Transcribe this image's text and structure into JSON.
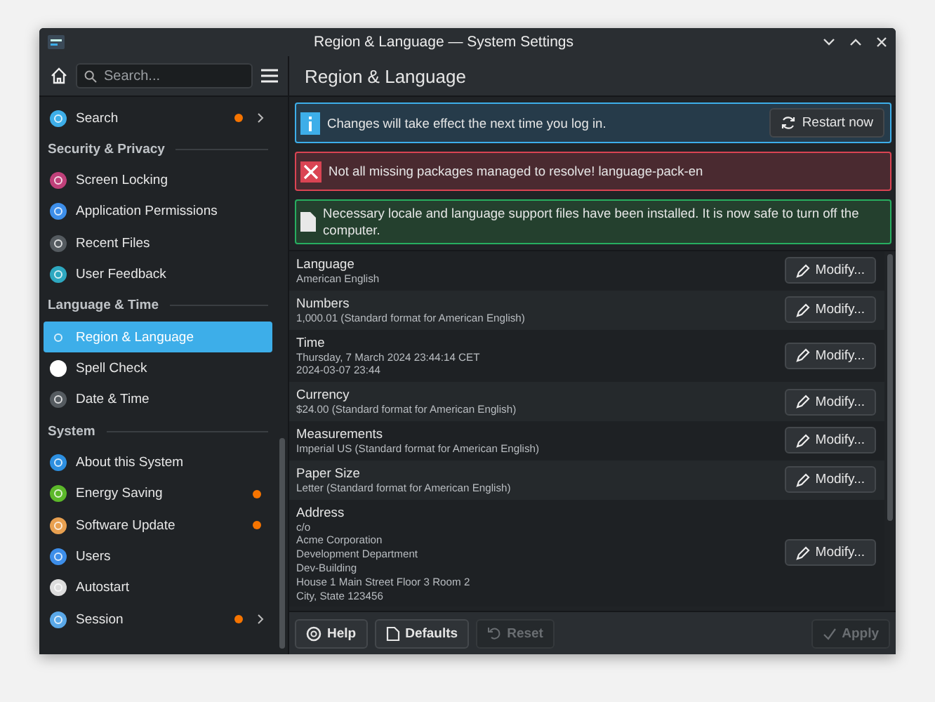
{
  "window": {
    "title": "Region & Language — System Settings"
  },
  "sidebar": {
    "search": {
      "placeholder": "Search..."
    },
    "items": [
      {
        "kind": "item",
        "label": "Search",
        "selected": false,
        "badge": true,
        "arrow": true
      },
      {
        "kind": "heading",
        "label": "Security & Privacy"
      },
      {
        "kind": "item",
        "label": "Screen Locking",
        "selected": false,
        "badge": false,
        "arrow": false
      },
      {
        "kind": "item",
        "label": "Application Permissions",
        "selected": false,
        "badge": false,
        "arrow": false
      },
      {
        "kind": "item",
        "label": "Recent Files",
        "selected": false,
        "badge": false,
        "arrow": false
      },
      {
        "kind": "item",
        "label": "User Feedback",
        "selected": false,
        "badge": false,
        "arrow": false
      },
      {
        "kind": "heading",
        "label": "Language & Time"
      },
      {
        "kind": "item",
        "label": "Region & Language",
        "selected": true,
        "badge": false,
        "arrow": false
      },
      {
        "kind": "item",
        "label": "Spell Check",
        "selected": false,
        "badge": false,
        "arrow": false
      },
      {
        "kind": "item",
        "label": "Date & Time",
        "selected": false,
        "badge": false,
        "arrow": false
      },
      {
        "kind": "heading",
        "label": "System"
      },
      {
        "kind": "item",
        "label": "About this System",
        "selected": false,
        "badge": false,
        "arrow": false
      },
      {
        "kind": "item",
        "label": "Energy Saving",
        "selected": false,
        "badge": true,
        "arrow": false
      },
      {
        "kind": "item",
        "label": "Software Update",
        "selected": false,
        "badge": true,
        "arrow": false
      },
      {
        "kind": "item",
        "label": "Users",
        "selected": false,
        "badge": false,
        "arrow": false
      },
      {
        "kind": "item",
        "label": "Autostart",
        "selected": false,
        "badge": false,
        "arrow": false
      },
      {
        "kind": "item",
        "label": "Session",
        "selected": false,
        "badge": true,
        "arrow": true
      }
    ]
  },
  "page": {
    "title": "Region & Language",
    "messages": [
      {
        "kind": "info",
        "text": "Changes will take effect the next time you log in.",
        "button": "Restart now"
      },
      {
        "kind": "error",
        "text": "Not all missing packages managed to resolve! language-pack-en"
      },
      {
        "kind": "positive",
        "text": "Necessary locale and language support files have been installed. It is now safe to turn off the computer."
      }
    ],
    "settings": [
      {
        "label": "Language",
        "lines": [
          "American English"
        ],
        "button": "Modify..."
      },
      {
        "label": "Numbers",
        "lines": [
          "1,000.01 (Standard format for American English)"
        ],
        "button": "Modify..."
      },
      {
        "label": "Time",
        "lines": [
          "Thursday, 7 March 2024 23:44:14 CET",
          "2024-03-07 23:44"
        ],
        "button": "Modify..."
      },
      {
        "label": "Currency",
        "lines": [
          "$24.00 (Standard format for American English)"
        ],
        "button": "Modify..."
      },
      {
        "label": "Measurements",
        "lines": [
          "Imperial US (Standard format for American English)"
        ],
        "button": "Modify..."
      },
      {
        "label": "Paper Size",
        "lines": [
          "Letter (Standard format for American English)"
        ],
        "button": "Modify..."
      },
      {
        "label": "Address",
        "lines": [
          "c/o",
          "Acme Corporation",
          "Development Department",
          "Dev-Building",
          "House 1 Main Street Floor 3 Room 2",
          "City, State 123456"
        ],
        "button": "Modify..."
      }
    ]
  },
  "footer": {
    "buttons": [
      {
        "kind": "help",
        "label": "Help",
        "disabled": false
      },
      {
        "kind": "defaults",
        "label": "Defaults",
        "disabled": false
      },
      {
        "kind": "reset",
        "label": "Reset",
        "disabled": true
      },
      {
        "kind": "apply",
        "label": "Apply",
        "disabled": true
      }
    ]
  }
}
